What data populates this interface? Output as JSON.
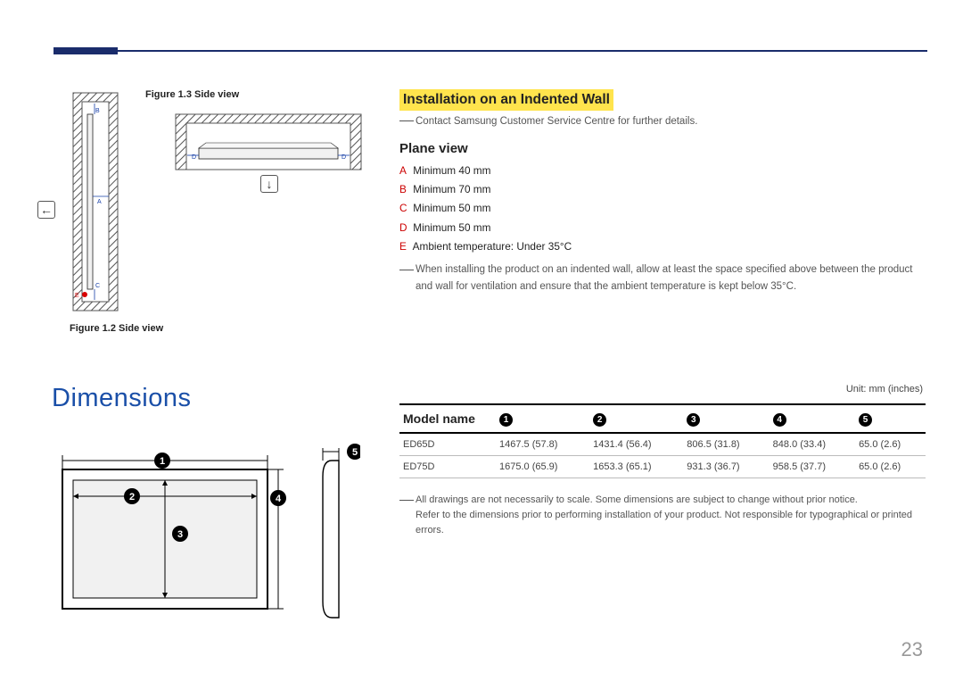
{
  "figure13_caption": "Figure 1.3 Side view",
  "figure12_caption": "Figure 1.2 Side view",
  "diagram_labels": {
    "A": "A",
    "B": "B",
    "C": "C",
    "D": "D",
    "E": "E"
  },
  "section": {
    "highlight": "Installation on an Indented Wall",
    "note1": "Contact Samsung Customer Service Centre for further details.",
    "plane_view": "Plane view",
    "kv": [
      {
        "k": "A",
        "v": "Minimum 40 mm"
      },
      {
        "k": "B",
        "v": "Minimum 70 mm"
      },
      {
        "k": "C",
        "v": "Minimum 50 mm"
      },
      {
        "k": "D",
        "v": "Minimum 50 mm"
      },
      {
        "k": "E",
        "v": "Ambient temperature: Under 35°C"
      }
    ],
    "note2": "When installing the product on an indented wall, allow at least the space specified above between the product and wall for ventilation and ensure that the ambient temperature is kept below 35°C."
  },
  "dimensions": {
    "title": "Dimensions",
    "unit": "Unit: mm (inches)",
    "headers": {
      "model": "Model name",
      "c1": "1",
      "c2": "2",
      "c3": "3",
      "c4": "4",
      "c5": "5"
    },
    "rows": [
      {
        "model": "ED65D",
        "c1": "1467.5 (57.8)",
        "c2": "1431.4 (56.4)",
        "c3": "806.5 (31.8)",
        "c4": "848.0 (33.4)",
        "c5": "65.0 (2.6)"
      },
      {
        "model": "ED75D",
        "c1": "1675.0 (65.9)",
        "c2": "1653.3 (65.1)",
        "c3": "931.3 (36.7)",
        "c4": "958.5 (37.7)",
        "c5": "65.0 (2.6)"
      }
    ],
    "note_a": "All drawings are not necessarily to scale. Some dimensions are subject to change without prior notice.",
    "note_b": "Refer to the dimensions prior to performing installation of your product. Not responsible for typographical or printed errors.",
    "diagram_circles": {
      "n1": "1",
      "n2": "2",
      "n3": "3",
      "n4": "4",
      "n5": "5"
    }
  },
  "page_number": "23",
  "chart_data": [
    {
      "type": "table",
      "title": "Dimensions",
      "unit": "mm (inches)",
      "columns": [
        "Model name",
        "1",
        "2",
        "3",
        "4",
        "5"
      ],
      "rows": [
        [
          "ED65D",
          "1467.5 (57.8)",
          "1431.4 (56.4)",
          "806.5 (31.8)",
          "848.0 (33.4)",
          "65.0 (2.6)"
        ],
        [
          "ED75D",
          "1675.0 (65.9)",
          "1653.3 (65.1)",
          "931.3 (36.7)",
          "958.5 (37.7)",
          "65.0 (2.6)"
        ]
      ]
    }
  ]
}
